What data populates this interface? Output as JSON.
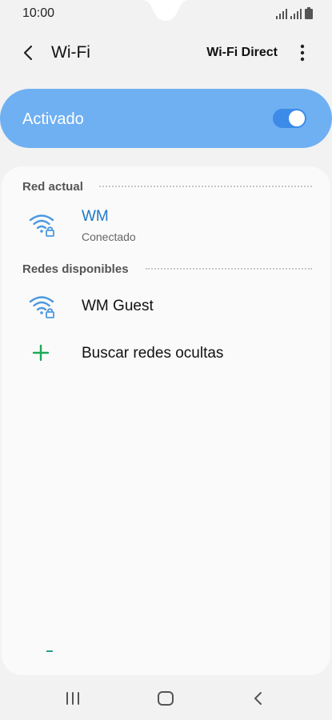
{
  "status_bar": {
    "time": "10:00",
    "icons": [
      "signal-icon",
      "signal-icon",
      "battery-icon"
    ]
  },
  "header": {
    "title": "Wi-Fi",
    "wifi_direct_label": "Wi-Fi Direct",
    "icons": [
      "back-icon",
      "more-vertical-icon"
    ]
  },
  "master_switch": {
    "label": "Activado",
    "on": true
  },
  "current_network": {
    "section_title": "Red actual",
    "network": {
      "name": "WM",
      "status": "Conectado",
      "icon": "wifi-locked-icon"
    }
  },
  "available_networks": {
    "section_title": "Redes disponibles",
    "networks": [
      {
        "name": "WM Guest",
        "icon": "wifi-locked-icon"
      }
    ],
    "add_hidden_label": "Buscar redes ocultas"
  },
  "navbar": {
    "icons": [
      "recents-icon",
      "home-icon",
      "back-icon"
    ]
  },
  "colors": {
    "accent": "#3c8be8",
    "toggle_bar": "#6fb0f2",
    "current_network_text": "#1f78c4",
    "plus_icon": "#1fa85a"
  }
}
